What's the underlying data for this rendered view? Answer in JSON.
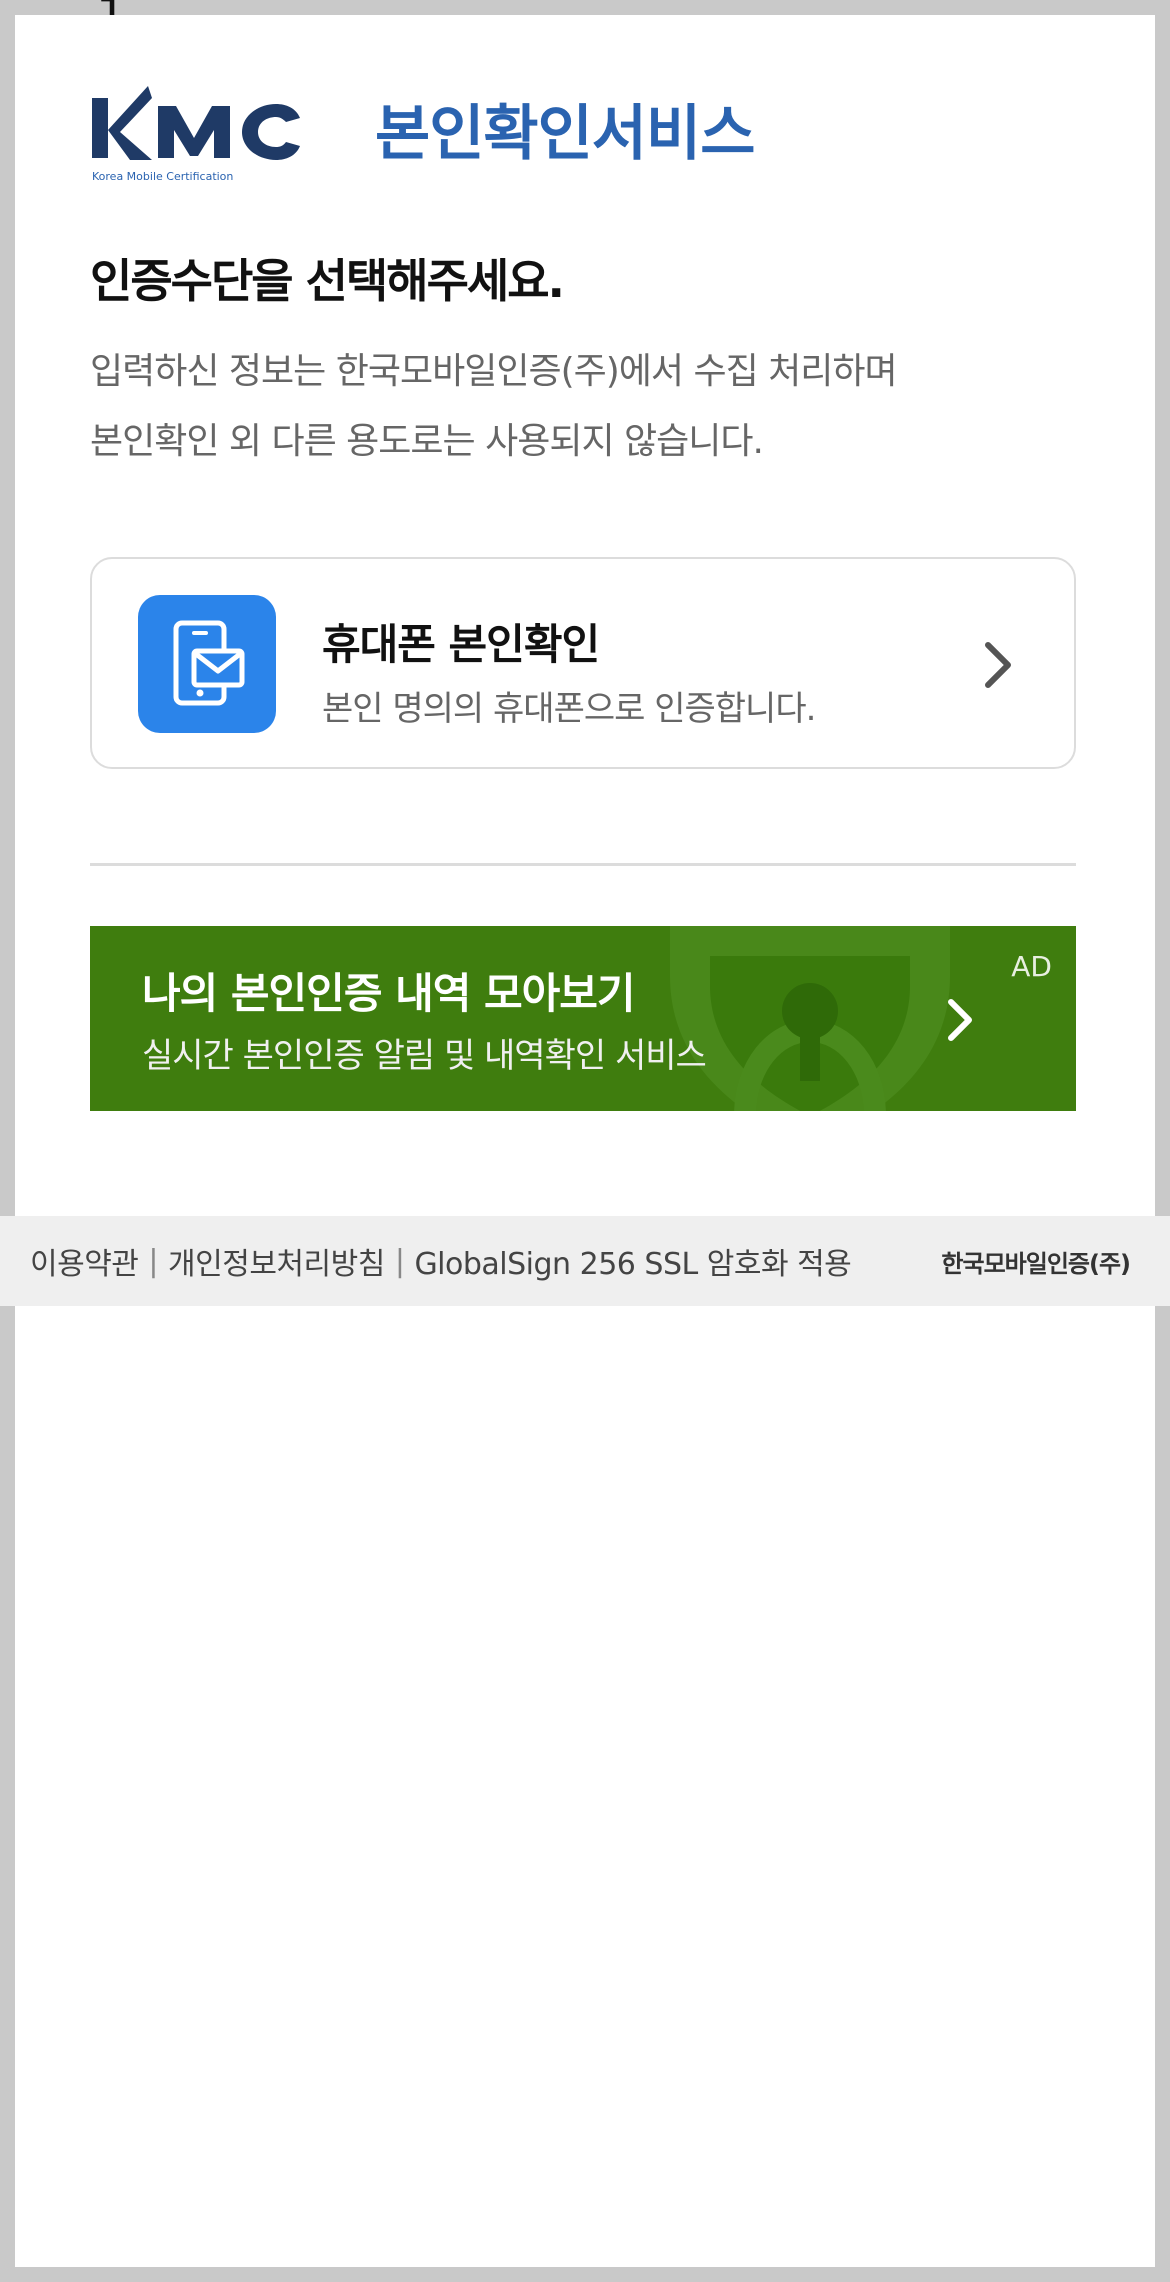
{
  "header": {
    "logo_text": "KMC",
    "logo_subtext": "Korea Mobile Certification",
    "service_title": "본인확인서비스"
  },
  "main": {
    "headline": "인증수단을 선택해주세요.",
    "description_line1": "입력하신 정보는 한국모바일인증(주)에서 수집 처리하며",
    "description_line2": "본인확인 외 다른 용도로는 사용되지 않습니다."
  },
  "auth_option": {
    "title": "휴대폰 본인확인",
    "subtitle": "본인 명의의 휴대폰으로 인증합니다.",
    "icon": "phone-message-icon"
  },
  "ad": {
    "title": "나의 본인인증 내역 모아보기",
    "subtitle": "실시간 본인인증 알림 및 내역확인 서비스",
    "label": "AD"
  },
  "footer": {
    "terms": "이용약관",
    "privacy": "개인정보처리방침",
    "ssl": "GlobalSign 256 SSL 암호화 적용",
    "separator": "|",
    "brand": "한국모바일인증(주)"
  },
  "colors": {
    "brand_blue": "#2a63b0",
    "icon_blue": "#2b84ea",
    "ad_green": "#3f7d0e",
    "footer_bg": "#efefef"
  }
}
